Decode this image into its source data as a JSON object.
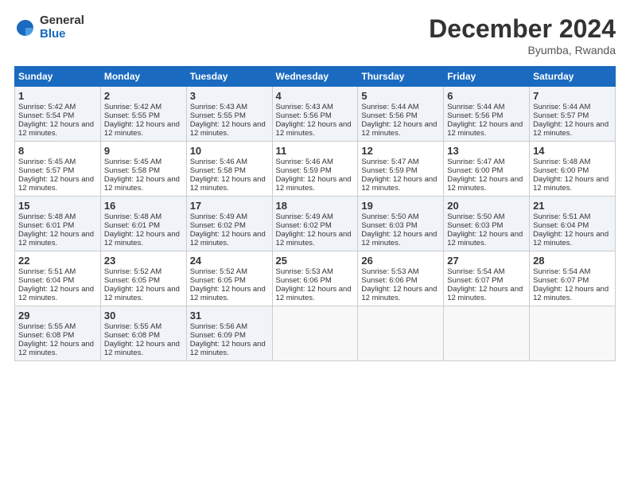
{
  "logo": {
    "general": "General",
    "blue": "Blue"
  },
  "title": "December 2024",
  "location": "Byumba, Rwanda",
  "days_of_week": [
    "Sunday",
    "Monday",
    "Tuesday",
    "Wednesday",
    "Thursday",
    "Friday",
    "Saturday"
  ],
  "weeks": [
    [
      {
        "day": "1",
        "sunrise": "Sunrise: 5:42 AM",
        "sunset": "Sunset: 5:54 PM",
        "daylight": "Daylight: 12 hours and 12 minutes."
      },
      {
        "day": "2",
        "sunrise": "Sunrise: 5:42 AM",
        "sunset": "Sunset: 5:55 PM",
        "daylight": "Daylight: 12 hours and 12 minutes."
      },
      {
        "day": "3",
        "sunrise": "Sunrise: 5:43 AM",
        "sunset": "Sunset: 5:55 PM",
        "daylight": "Daylight: 12 hours and 12 minutes."
      },
      {
        "day": "4",
        "sunrise": "Sunrise: 5:43 AM",
        "sunset": "Sunset: 5:56 PM",
        "daylight": "Daylight: 12 hours and 12 minutes."
      },
      {
        "day": "5",
        "sunrise": "Sunrise: 5:44 AM",
        "sunset": "Sunset: 5:56 PM",
        "daylight": "Daylight: 12 hours and 12 minutes."
      },
      {
        "day": "6",
        "sunrise": "Sunrise: 5:44 AM",
        "sunset": "Sunset: 5:56 PM",
        "daylight": "Daylight: 12 hours and 12 minutes."
      },
      {
        "day": "7",
        "sunrise": "Sunrise: 5:44 AM",
        "sunset": "Sunset: 5:57 PM",
        "daylight": "Daylight: 12 hours and 12 minutes."
      }
    ],
    [
      {
        "day": "8",
        "sunrise": "Sunrise: 5:45 AM",
        "sunset": "Sunset: 5:57 PM",
        "daylight": "Daylight: 12 hours and 12 minutes."
      },
      {
        "day": "9",
        "sunrise": "Sunrise: 5:45 AM",
        "sunset": "Sunset: 5:58 PM",
        "daylight": "Daylight: 12 hours and 12 minutes."
      },
      {
        "day": "10",
        "sunrise": "Sunrise: 5:46 AM",
        "sunset": "Sunset: 5:58 PM",
        "daylight": "Daylight: 12 hours and 12 minutes."
      },
      {
        "day": "11",
        "sunrise": "Sunrise: 5:46 AM",
        "sunset": "Sunset: 5:59 PM",
        "daylight": "Daylight: 12 hours and 12 minutes."
      },
      {
        "day": "12",
        "sunrise": "Sunrise: 5:47 AM",
        "sunset": "Sunset: 5:59 PM",
        "daylight": "Daylight: 12 hours and 12 minutes."
      },
      {
        "day": "13",
        "sunrise": "Sunrise: 5:47 AM",
        "sunset": "Sunset: 6:00 PM",
        "daylight": "Daylight: 12 hours and 12 minutes."
      },
      {
        "day": "14",
        "sunrise": "Sunrise: 5:48 AM",
        "sunset": "Sunset: 6:00 PM",
        "daylight": "Daylight: 12 hours and 12 minutes."
      }
    ],
    [
      {
        "day": "15",
        "sunrise": "Sunrise: 5:48 AM",
        "sunset": "Sunset: 6:01 PM",
        "daylight": "Daylight: 12 hours and 12 minutes."
      },
      {
        "day": "16",
        "sunrise": "Sunrise: 5:48 AM",
        "sunset": "Sunset: 6:01 PM",
        "daylight": "Daylight: 12 hours and 12 minutes."
      },
      {
        "day": "17",
        "sunrise": "Sunrise: 5:49 AM",
        "sunset": "Sunset: 6:02 PM",
        "daylight": "Daylight: 12 hours and 12 minutes."
      },
      {
        "day": "18",
        "sunrise": "Sunrise: 5:49 AM",
        "sunset": "Sunset: 6:02 PM",
        "daylight": "Daylight: 12 hours and 12 minutes."
      },
      {
        "day": "19",
        "sunrise": "Sunrise: 5:50 AM",
        "sunset": "Sunset: 6:03 PM",
        "daylight": "Daylight: 12 hours and 12 minutes."
      },
      {
        "day": "20",
        "sunrise": "Sunrise: 5:50 AM",
        "sunset": "Sunset: 6:03 PM",
        "daylight": "Daylight: 12 hours and 12 minutes."
      },
      {
        "day": "21",
        "sunrise": "Sunrise: 5:51 AM",
        "sunset": "Sunset: 6:04 PM",
        "daylight": "Daylight: 12 hours and 12 minutes."
      }
    ],
    [
      {
        "day": "22",
        "sunrise": "Sunrise: 5:51 AM",
        "sunset": "Sunset: 6:04 PM",
        "daylight": "Daylight: 12 hours and 12 minutes."
      },
      {
        "day": "23",
        "sunrise": "Sunrise: 5:52 AM",
        "sunset": "Sunset: 6:05 PM",
        "daylight": "Daylight: 12 hours and 12 minutes."
      },
      {
        "day": "24",
        "sunrise": "Sunrise: 5:52 AM",
        "sunset": "Sunset: 6:05 PM",
        "daylight": "Daylight: 12 hours and 12 minutes."
      },
      {
        "day": "25",
        "sunrise": "Sunrise: 5:53 AM",
        "sunset": "Sunset: 6:06 PM",
        "daylight": "Daylight: 12 hours and 12 minutes."
      },
      {
        "day": "26",
        "sunrise": "Sunrise: 5:53 AM",
        "sunset": "Sunset: 6:06 PM",
        "daylight": "Daylight: 12 hours and 12 minutes."
      },
      {
        "day": "27",
        "sunrise": "Sunrise: 5:54 AM",
        "sunset": "Sunset: 6:07 PM",
        "daylight": "Daylight: 12 hours and 12 minutes."
      },
      {
        "day": "28",
        "sunrise": "Sunrise: 5:54 AM",
        "sunset": "Sunset: 6:07 PM",
        "daylight": "Daylight: 12 hours and 12 minutes."
      }
    ],
    [
      {
        "day": "29",
        "sunrise": "Sunrise: 5:55 AM",
        "sunset": "Sunset: 6:08 PM",
        "daylight": "Daylight: 12 hours and 12 minutes."
      },
      {
        "day": "30",
        "sunrise": "Sunrise: 5:55 AM",
        "sunset": "Sunset: 6:08 PM",
        "daylight": "Daylight: 12 hours and 12 minutes."
      },
      {
        "day": "31",
        "sunrise": "Sunrise: 5:56 AM",
        "sunset": "Sunset: 6:09 PM",
        "daylight": "Daylight: 12 hours and 12 minutes."
      },
      null,
      null,
      null,
      null
    ]
  ]
}
